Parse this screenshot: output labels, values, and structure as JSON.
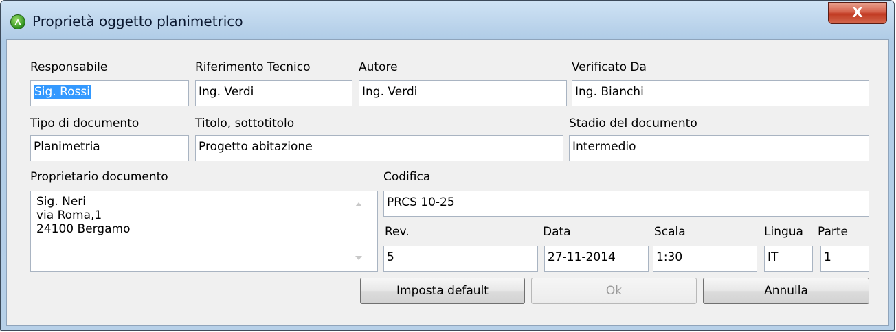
{
  "window": {
    "title": "Proprietà oggetto planimetrico",
    "close_label": "X"
  },
  "labels": {
    "responsabile": "Responsabile",
    "riferimento": "Riferimento Tecnico",
    "autore": "Autore",
    "verificato": "Verificato Da",
    "tipo": "Tipo di documento",
    "titolo": "Titolo, sottotitolo",
    "stadio": "Stadio del documento",
    "proprietario": "Proprietario documento",
    "codifica": "Codifica",
    "rev": "Rev.",
    "data": "Data",
    "scala": "Scala",
    "lingua": "Lingua",
    "parte": "Parte"
  },
  "fields": {
    "responsabile": "Sig. Rossi",
    "riferimento": "Ing. Verdi",
    "autore": "Ing. Verdi",
    "verificato": "Ing. Bianchi",
    "tipo": "Planimetria",
    "titolo": "Progetto abitazione",
    "stadio": "Intermedio",
    "proprietario": [
      "Sig. Neri",
      "via Roma,1",
      "24100 Bergamo"
    ],
    "codifica": "PRCS 10-25",
    "rev": "5",
    "data": "27-11-2014",
    "scala": "1:30",
    "lingua": "IT",
    "parte": "1"
  },
  "buttons": {
    "default": "Imposta default",
    "ok": "Ok",
    "cancel": "Annulla"
  },
  "icons": {
    "app": "app-logo-icon",
    "close": "close-icon"
  },
  "colors": {
    "selection": "#3399ff",
    "close": "#c13a22"
  }
}
